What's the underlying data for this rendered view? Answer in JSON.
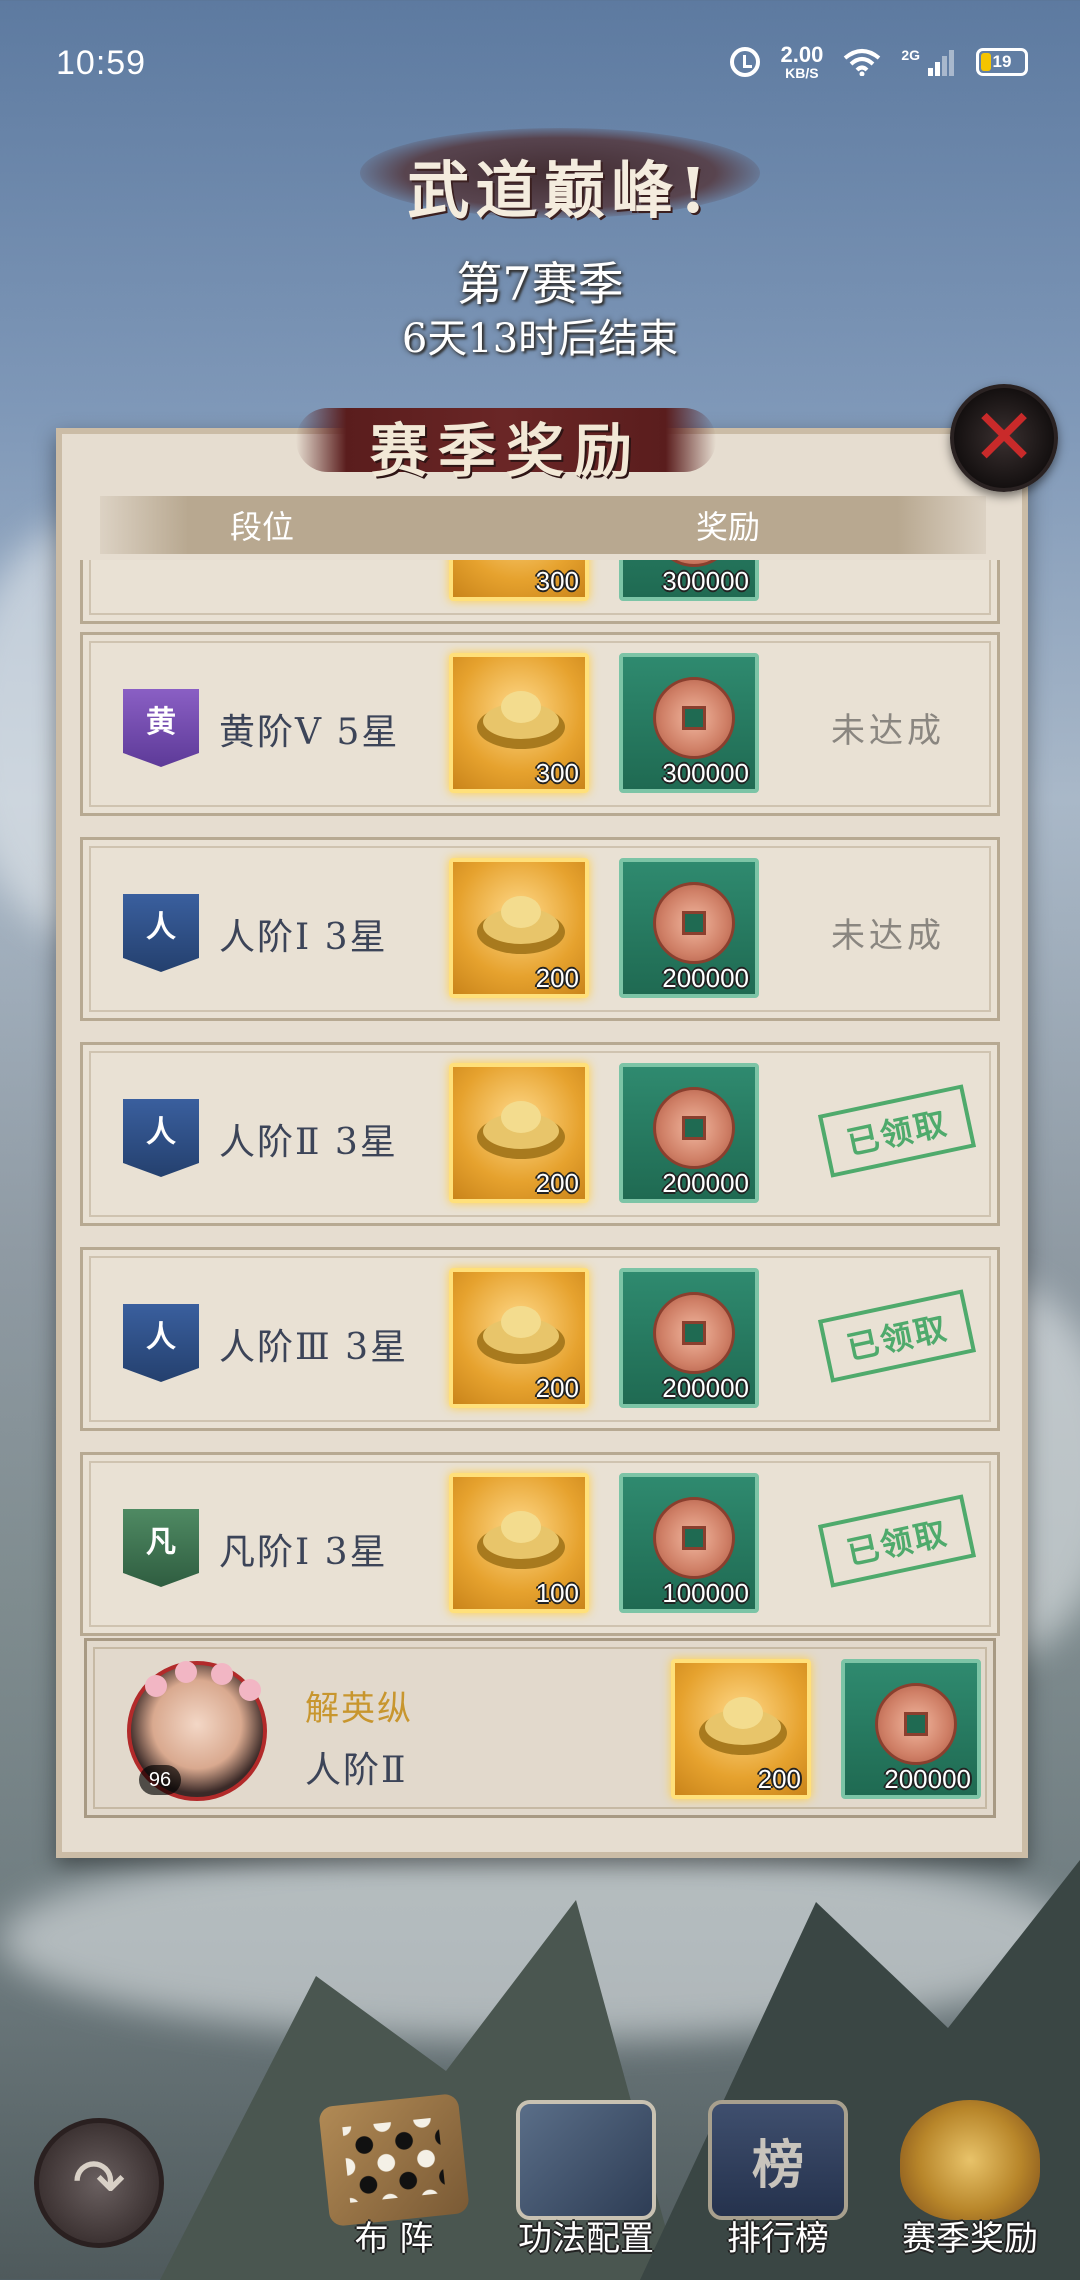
{
  "status_bar": {
    "time": "10:59",
    "speed_value": "2.00",
    "speed_unit": "KB/S",
    "network": "2G",
    "battery": "19",
    "icons": [
      "alarm-icon",
      "wifi-icon",
      "signal-icon",
      "battery-icon"
    ]
  },
  "header": {
    "title": "武道巅峰!",
    "season": "第7赛季",
    "countdown": "6天13时后结束"
  },
  "panel": {
    "title": "赛季奖励",
    "close_icon": "✕",
    "columns": {
      "rank": "段位",
      "reward": "奖励"
    }
  },
  "rows": [
    {
      "rank_badge": "",
      "rank_label": "",
      "gold": "300",
      "coin": "300000",
      "status": "",
      "claimed": false,
      "badge_color": "purple"
    },
    {
      "rank_badge": "黄",
      "rank_label": "黄阶Ⅴ 5星",
      "gold": "300",
      "coin": "300000",
      "status": "未达成",
      "claimed": false,
      "badge_color": "purple"
    },
    {
      "rank_badge": "人",
      "rank_label": "人阶Ⅰ 3星",
      "gold": "200",
      "coin": "200000",
      "status": "未达成",
      "claimed": false,
      "badge_color": "blue"
    },
    {
      "rank_badge": "人",
      "rank_label": "人阶Ⅱ 3星",
      "gold": "200",
      "coin": "200000",
      "status": "已领取",
      "claimed": true,
      "badge_color": "blue"
    },
    {
      "rank_badge": "人",
      "rank_label": "人阶Ⅲ 3星",
      "gold": "200",
      "coin": "200000",
      "status": "已领取",
      "claimed": true,
      "badge_color": "blue"
    },
    {
      "rank_badge": "凡",
      "rank_label": "凡阶Ⅰ 3星",
      "gold": "100",
      "coin": "100000",
      "status": "已领取",
      "claimed": true,
      "badge_color": "green"
    }
  ],
  "player": {
    "name": "解英纵",
    "rank": "人阶Ⅱ",
    "level": "96",
    "gold": "200",
    "coin": "200000"
  },
  "bottom_nav": {
    "back_icon": "↶",
    "items": [
      {
        "label": "布 阵",
        "icon": "go-board-icon"
      },
      {
        "label": "功法配置",
        "icon": "books-icon"
      },
      {
        "label": "排行榜",
        "icon": "ranking-banner-icon",
        "glyph": "榜"
      },
      {
        "label": "赛季奖励",
        "icon": "treasure-pot-icon"
      }
    ]
  },
  "colors": {
    "accent_red": "#c92a2a",
    "claimed_green": "#4faa6c",
    "gold_name": "#c8962e"
  }
}
